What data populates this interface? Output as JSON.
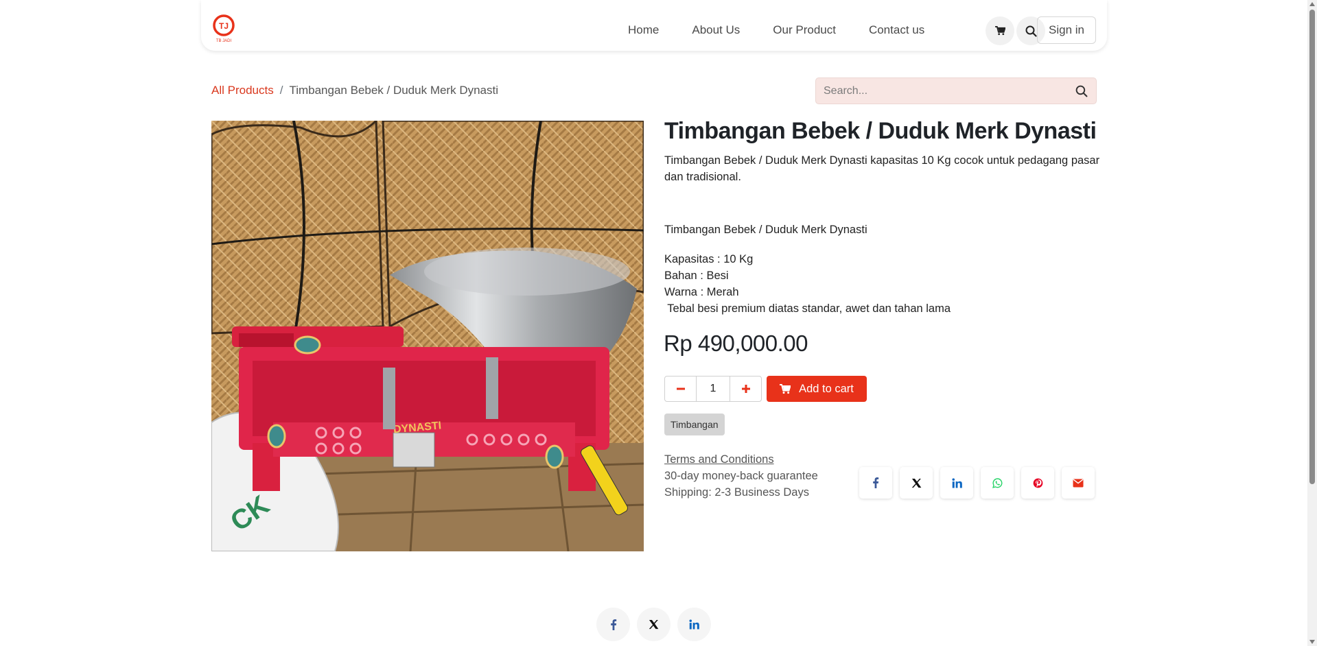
{
  "header": {
    "logo_text": "TB JADI",
    "nav": [
      "Home",
      "About Us",
      "Our Product",
      "Contact us"
    ],
    "signin_label": "Sign in"
  },
  "breadcrumb": {
    "all_products": "All Products",
    "separator": "/",
    "current": "Timbangan Bebek / Duduk Merk Dynasti"
  },
  "search": {
    "placeholder": "Search..."
  },
  "product": {
    "title": "Timbangan Bebek / Duduk Merk Dynasti",
    "description": "Timbangan Bebek / Duduk Merk Dynasti kapasitas 10 Kg cocok untuk pedagang pasar dan tradisional.",
    "name_line": "Timbangan Bebek / Duduk Merk Dynasti",
    "specs": [
      "Kapasitas : 10 Kg",
      "Bahan : Besi",
      "Warna : Merah",
      " Tebal besi premium diatas standar, awet dan tahan lama"
    ],
    "price": "Rp 490,000.00",
    "quantity": "1",
    "add_to_cart": "Add to cart",
    "tag": "Timbangan",
    "image_text": "DYNASTI"
  },
  "info": {
    "terms": "Terms and Conditions",
    "guarantee": "30-day money-back guarantee",
    "shipping": "Shipping: 2-3 Business Days"
  },
  "share_icons": [
    "facebook-icon",
    "x-twitter-icon",
    "linkedin-icon",
    "whatsapp-icon",
    "pinterest-icon",
    "email-icon"
  ],
  "footer_icons": [
    "facebook-icon",
    "x-twitter-icon",
    "linkedin-icon"
  ],
  "colors": {
    "accent": "#e8321a",
    "link": "#d9381e",
    "facebook": "#3b5998",
    "linkedin": "#0a66c2",
    "whatsapp": "#25d366",
    "pinterest": "#e60023"
  }
}
